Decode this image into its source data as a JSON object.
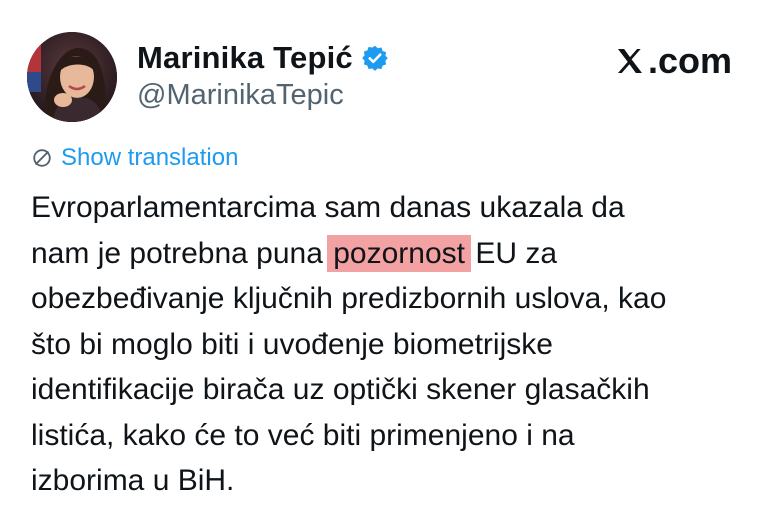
{
  "author": {
    "display_name": "Marinika Tepić",
    "handle": "@MarinikaTepic",
    "verified": true,
    "avatar_icon": "profile-photo"
  },
  "brand": {
    "label": ".com",
    "logo_icon": "x-logo-icon"
  },
  "translate": {
    "label": "Show translation",
    "icon": "globe-icon"
  },
  "tweet": {
    "line1": "Evroparlamentarcima sam danas ukazala da",
    "line2_before": "nam je potrebna puna ",
    "line2_highlight": "pozornost",
    "line2_after": " EU za",
    "line3": "obezbeđivanje ključnih predizbornih uslova, kao",
    "line4": "što bi moglo biti i uvođenje biometrijske",
    "line5": "identifikacije birača uz optički skener glasačkih",
    "line6": "listića, kako će to već biti primenjeno i na",
    "line7": "izborima u BiH."
  },
  "colors": {
    "accent": "#1d9bf0",
    "highlight": "#f2a2a3",
    "text": "#0f1419",
    "secondary": "#536471"
  }
}
